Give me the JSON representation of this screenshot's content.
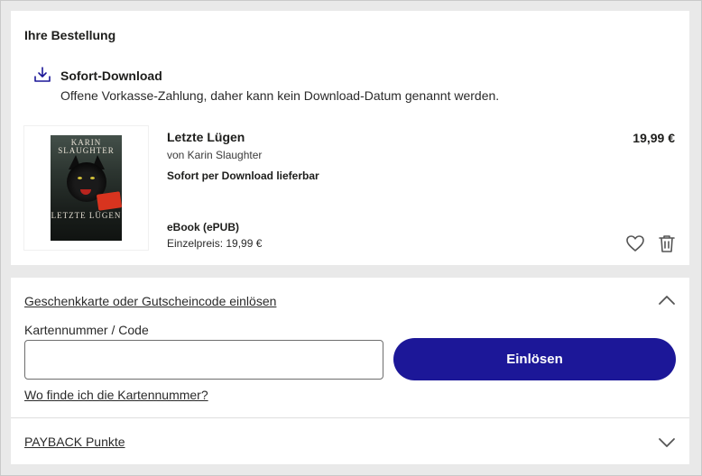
{
  "order": {
    "title": "Ihre Bestellung",
    "download": {
      "icon": "download-icon",
      "heading": "Sofort-Download",
      "note": "Offene Vorkasse-Zahlung, daher kann kein Download-Datum genannt werden."
    },
    "item": {
      "cover": {
        "author": "KARIN SLAUGHTER",
        "title": "LETZTE LÜGEN"
      },
      "title": "Letzte Lügen",
      "author": "von Karin Slaughter",
      "availability": "Sofort per Download lieferbar",
      "format": "eBook (ePUB)",
      "unit_price": "Einzelpreis: 19,99 €",
      "price": "19,99 €"
    },
    "actions": {
      "wishlist_icon": "heart-icon",
      "delete_icon": "trash-icon"
    }
  },
  "voucher": {
    "toggle_label": "Geschenkkarte oder Gutscheincode einlösen",
    "toggle_icon": "chevron-up-icon",
    "field_label": "Kartennummer / Code",
    "field_value": "",
    "redeem_label": "Einlösen",
    "help_label": "Wo finde ich die Kartennummer?",
    "payback_label": "PAYBACK Punkte",
    "payback_icon": "chevron-down-icon"
  },
  "colors": {
    "accent": "#1c1798",
    "background": "#e9e9e9",
    "card": "#ffffff"
  }
}
